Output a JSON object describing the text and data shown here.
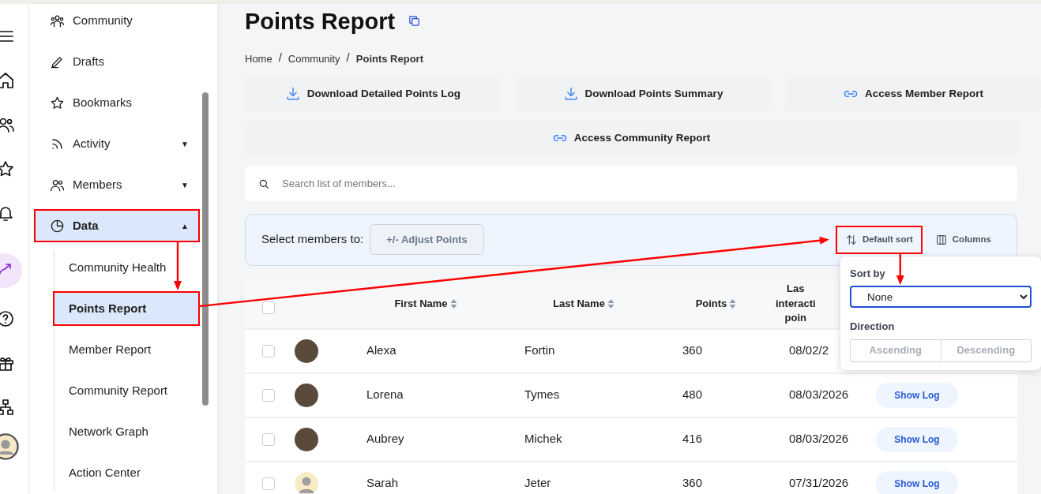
{
  "rail": {
    "items": [
      {
        "selected": false
      },
      {
        "selected": false
      },
      {
        "selected": false
      },
      {
        "selected": false
      },
      {
        "selected": false
      },
      {
        "selected": true
      },
      {
        "selected": false
      },
      {
        "selected": false
      },
      {
        "selected": false
      },
      {
        "selected": false
      }
    ]
  },
  "sidebar": {
    "items": [
      {
        "kind": "link",
        "label": "Community",
        "selected": false,
        "highlighted": false
      },
      {
        "kind": "link",
        "label": "Drafts",
        "selected": false,
        "highlighted": false
      },
      {
        "kind": "link",
        "label": "Bookmarks",
        "selected": false,
        "highlighted": false
      },
      {
        "kind": "group",
        "label": "Activity",
        "caret": "▼",
        "selected": false,
        "highlighted": false
      },
      {
        "kind": "group",
        "label": "Members",
        "caret": "▼",
        "selected": false,
        "highlighted": false
      },
      {
        "kind": "group",
        "label": "Data",
        "caret": "▲",
        "expanded": true,
        "selected": true,
        "highlighted": true,
        "children": [
          {
            "label": "Community Health",
            "selected": false,
            "highlighted": false
          },
          {
            "label": "Points Report",
            "selected": true,
            "highlighted": true
          },
          {
            "label": "Member Report",
            "selected": false,
            "highlighted": false
          },
          {
            "label": "Community Report",
            "selected": false,
            "highlighted": false
          },
          {
            "label": "Network Graph",
            "selected": false,
            "highlighted": false
          },
          {
            "label": "Action Center",
            "selected": false,
            "highlighted": false
          }
        ]
      }
    ]
  },
  "page": {
    "title": "Points Report",
    "breadcrumb": [
      {
        "label": "Home",
        "current": false
      },
      {
        "separator": "/",
        "label": "Community",
        "current": false
      },
      {
        "separator": "/",
        "label": "Points Report",
        "current": true
      }
    ]
  },
  "actions": [
    {
      "kind": "download",
      "label": "Download Detailed Points Log"
    },
    {
      "kind": "download",
      "label": "Download Points Summary"
    },
    {
      "kind": "link",
      "label": "Access Member Report"
    },
    {
      "kind": "link",
      "label": "Access Community Report"
    }
  ],
  "search": {
    "placeholder": "Search list of members..."
  },
  "toolbar": {
    "label": "Select members to:",
    "adjust_button": {
      "label": "+/- Adjust Points",
      "disabled": true
    },
    "sort_button": {
      "label": "Default sort",
      "highlighted": true
    },
    "columns_button": {
      "label": "Columns"
    }
  },
  "table": {
    "select_all_checked": false,
    "columns": [
      {
        "label": "First Name",
        "sortable": true
      },
      {
        "label": "Last Name",
        "sortable": true
      },
      {
        "label": "Points",
        "sortable": true
      },
      {
        "label": "Las interacti poin"
      }
    ],
    "rows": [
      {
        "kind": "photo",
        "checked": false,
        "first_name": "Alexa",
        "last_name": "Fortin",
        "points": "360",
        "date": "08/02/2"
      },
      {
        "kind": "photo",
        "checked": false,
        "first_name": "Lorena",
        "last_name": "Tymes",
        "points": "480",
        "date": "08/03/2026",
        "action": "Show Log"
      },
      {
        "kind": "photo",
        "checked": false,
        "first_name": "Aubrey",
        "last_name": "Michek",
        "points": "416",
        "date": "08/03/2026",
        "action": "Show Log"
      },
      {
        "kind": "default",
        "checked": false,
        "first_name": "Sarah",
        "last_name": "Jeter",
        "points": "360",
        "date": "07/31/2026",
        "action": "Show Log"
      }
    ]
  },
  "sort_popup": {
    "sort_by_label": "Sort by",
    "sort_by_value": "None",
    "arrow_target": true,
    "direction_label": "Direction",
    "directions": [
      {
        "label": "Ascending",
        "selected": false,
        "disabled": true
      },
      {
        "label": "Descending",
        "selected": false,
        "disabled": true
      }
    ]
  }
}
